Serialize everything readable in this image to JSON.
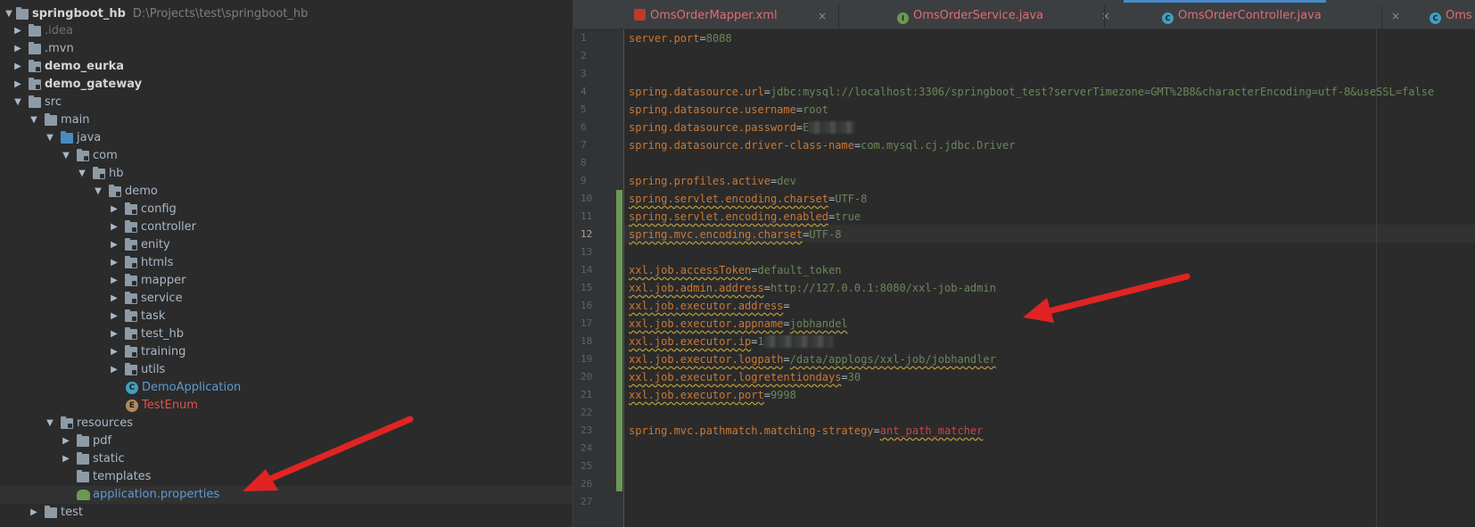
{
  "project": {
    "root_name": "springboot_hb",
    "root_path": "D:\\Projects\\test\\springboot_hb",
    "items": [
      {
        "label": ".idea"
      },
      {
        "label": ".mvn"
      },
      {
        "label": "demo_eurka"
      },
      {
        "label": "demo_gateway"
      },
      {
        "label": "src"
      },
      {
        "label": "main"
      },
      {
        "label": "java"
      },
      {
        "label": "com"
      },
      {
        "label": "hb"
      },
      {
        "label": "demo"
      },
      {
        "label": "config"
      },
      {
        "label": "controller"
      },
      {
        "label": "enity"
      },
      {
        "label": "htmls"
      },
      {
        "label": "mapper"
      },
      {
        "label": "service"
      },
      {
        "label": "task"
      },
      {
        "label": "test_hb"
      },
      {
        "label": "training"
      },
      {
        "label": "utils"
      },
      {
        "label": "DemoApplication"
      },
      {
        "label": "TestEnum"
      },
      {
        "label": "resources"
      },
      {
        "label": "pdf"
      },
      {
        "label": "static"
      },
      {
        "label": "templates"
      },
      {
        "label": "application.properties"
      },
      {
        "label": "test"
      }
    ]
  },
  "tabs": [
    {
      "label": "OmsOrderMapper.xml",
      "close": "×"
    },
    {
      "label": "OmsOrderService.java",
      "close": "×"
    },
    {
      "label": "OmsOrderController.java",
      "close": "×"
    },
    {
      "label": "Oms",
      "close": ""
    }
  ],
  "icon_letters": {
    "interface": "I",
    "class": "C",
    "enum": "E"
  },
  "line_numbers": [
    "1",
    "2",
    "3",
    "4",
    "5",
    "6",
    "7",
    "8",
    "9",
    "10",
    "11",
    "12",
    "13",
    "14",
    "15",
    "16",
    "17",
    "18",
    "19",
    "20",
    "21",
    "22",
    "23",
    "24",
    "25",
    "26",
    "27"
  ],
  "code": {
    "l1k": "server.port",
    "l1v": "8088",
    "l4k": "spring.datasource.url",
    "l4v": "jdbc:mysql://localhost:3306/springboot_test?serverTimezone=GMT%2B8&characterEncoding=utf-8&useSSL=false",
    "l5k": "spring.datasource.username",
    "l5v": "root",
    "l6k": "spring.datasource.password",
    "l6v": "E",
    "l7k": "spring.datasource.driver-class-name",
    "l7v": "com.mysql.cj.jdbc.Driver",
    "l9k": "spring.profiles.active",
    "l9v": "dev",
    "l10k": "spring.servlet.encoding.charset",
    "l10v": "UTF-8",
    "l11k": "spring.servlet.encoding.enabled",
    "l11v": "true",
    "l12k": "spring.mvc.encoding.charset",
    "l12v": "UTF-8",
    "l14k": "xxl.job.accessToken",
    "l14v": "default_token",
    "l15k": "xxl.job.admin.address",
    "l15v": "http://127.0.0.1:8080/xxl-job-admin",
    "l16k": "xxl.job.executor.address",
    "l16v": "",
    "l17k": "xxl.job.executor.appname",
    "l17v": "jobhandel",
    "l18k": "xxl.job.executor.ip",
    "l18v": "1",
    "l19k": "xxl.job.executor.logpath",
    "l19v": "/data/applogs/xxl-job/jobhandler",
    "l20k": "xxl.job.executor.logretentiondays",
    "l20v": "30",
    "l21k": "xxl.job.executor.port",
    "l21v": "9998",
    "l23k": "spring.mvc.pathmatch.matching-strategy",
    "l23v": "ant_path_matcher",
    "eq": "="
  },
  "colors": {
    "accent": "#4a88c7",
    "annotation_arrow": "#e02424",
    "key": "#cc7832",
    "value": "#6a8759"
  }
}
